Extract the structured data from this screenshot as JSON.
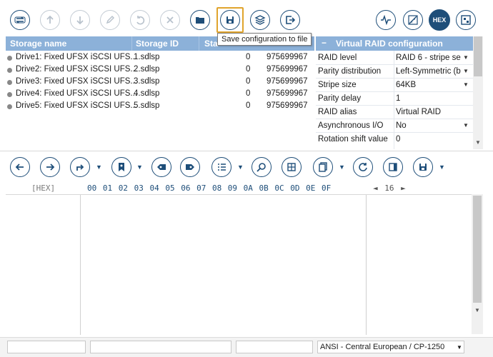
{
  "toolbar_top": {
    "buttons": [
      {
        "icon": "switch-icon",
        "label": ""
      },
      {
        "icon": "arrow-up-icon",
        "label": ""
      },
      {
        "icon": "arrow-down-icon",
        "label": ""
      },
      {
        "icon": "pencil-icon",
        "label": ""
      },
      {
        "icon": "undo-icon",
        "label": ""
      },
      {
        "icon": "close-icon",
        "label": ""
      },
      {
        "icon": "folder-open-icon",
        "label": ""
      },
      {
        "icon": "save-icon",
        "label": ""
      },
      {
        "icon": "layers-icon",
        "label": ""
      },
      {
        "icon": "export-icon",
        "label": ""
      },
      {
        "icon": "waveform-icon",
        "label": ""
      },
      {
        "icon": "chart-icon",
        "label": ""
      },
      {
        "icon": "hex-icon",
        "label": "HEX"
      },
      {
        "icon": "grid-icon",
        "label": ""
      }
    ],
    "tooltip": "Save configuration to file"
  },
  "drives_table": {
    "columns": [
      "Storage name",
      "Storage ID",
      "Sta"
    ],
    "rows": [
      {
        "name": "Drive1: Fixed UFSX iSCSI UFS...",
        "id": "1.sdlsp",
        "start": "0",
        "size": "975699967"
      },
      {
        "name": "Drive2: Fixed UFSX iSCSI UFS...",
        "id": "2.sdlsp",
        "start": "0",
        "size": "975699967"
      },
      {
        "name": "Drive3: Fixed UFSX iSCSI UFS...",
        "id": "3.sdlsp",
        "start": "0",
        "size": "975699967"
      },
      {
        "name": "Drive4: Fixed UFSX iSCSI UFS...",
        "id": "4.sdlsp",
        "start": "0",
        "size": "975699967"
      },
      {
        "name": "Drive5: Fixed UFSX iSCSI UFS...",
        "id": "5.sdlsp",
        "start": "0",
        "size": "975699967"
      }
    ]
  },
  "raid_config": {
    "collapse_glyph": "−",
    "title": "Virtual RAID configuration",
    "properties": [
      {
        "key": "RAID level",
        "value": "RAID 6 - stripe se",
        "dropdown": true
      },
      {
        "key": "Parity distribution",
        "value": "Left-Symmetric (b",
        "dropdown": true
      },
      {
        "key": "Stripe size",
        "value": "64KB",
        "dropdown": true
      },
      {
        "key": "Parity delay",
        "value": "1",
        "dropdown": false
      },
      {
        "key": "RAID alias",
        "value": "Virtual RAID",
        "dropdown": false
      },
      {
        "key": "Asynchronous I/O",
        "value": "No",
        "dropdown": true
      },
      {
        "key": "Rotation shift value",
        "value": "0",
        "dropdown": false
      }
    ]
  },
  "hex_view": {
    "label": "[HEX]",
    "columns": "00 01 02 03 04 05 06 07 08 09 0A 0B 0C 0D 0E 0F",
    "page_prev": "◄",
    "page_value": "16",
    "page_next": "►"
  },
  "statusbar": {
    "encoding": "ANSI - Central European / CP-1250"
  },
  "colors": {
    "accent": "#1e4e79",
    "header_bg": "#8cb1d9",
    "highlight": "#e0a42c"
  }
}
